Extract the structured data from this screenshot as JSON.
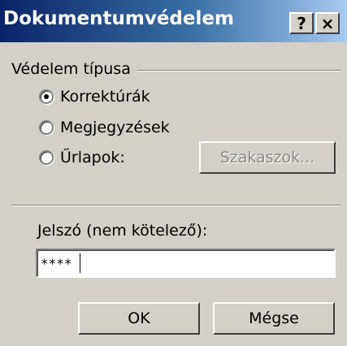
{
  "dialog": {
    "title": "Dokumentumvédelem",
    "help_button": "?",
    "close_button": "×"
  },
  "protection": {
    "group_label": "Védelem típusa",
    "options": [
      {
        "label": "Korrektúrák",
        "selected": true
      },
      {
        "label": "Megjegyzések",
        "selected": false
      },
      {
        "label": "Űrlapok:",
        "selected": false
      }
    ],
    "sections_button": "Szakaszok..."
  },
  "password": {
    "label": "Jelszó (nem kötelező):",
    "value": "****"
  },
  "buttons": {
    "ok": "OK",
    "cancel": "Mégse"
  }
}
